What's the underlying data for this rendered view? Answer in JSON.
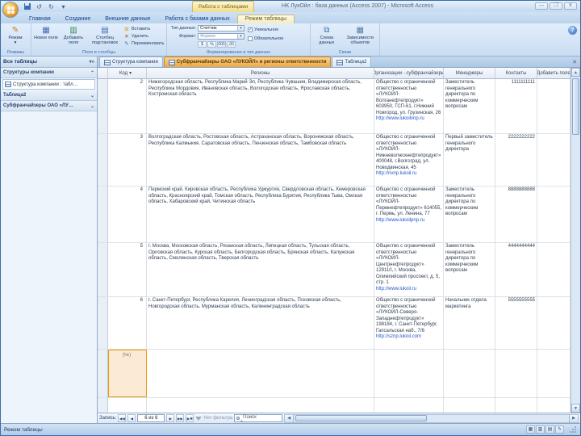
{
  "colors": {
    "active_doc_tab": "#efa743",
    "contextual_tab": "#f1dd8e",
    "title_bar": "#c2d9f0",
    "new_record_highlight": "#f0960f"
  },
  "window": {
    "title": "НК ЛукОйл : база данных (Access 2007) - Microsoft Access",
    "contextual_group": "Работа с таблицами",
    "controls": {
      "minimize": "—",
      "restore": "❐",
      "close": "✕"
    }
  },
  "ribbon": {
    "tabs": [
      "Главная",
      "Создание",
      "Внешние данные",
      "Работа с базами данных",
      "Режим таблицы"
    ],
    "views_group": {
      "label": "Режимы",
      "view_button": "Режим",
      "dropdown": "▾"
    },
    "fields_group": {
      "label": "Поля и столбцы",
      "new_field": "Новое поле",
      "add_fields": "Добавить поля",
      "lookup_column": "Столбец подстановок",
      "insert": "Вставить",
      "delete": "Удалить",
      "rename": "Переименовать"
    },
    "format_group": {
      "label": "Форматирование и тип данных",
      "data_type_label": "Тип данных:",
      "data_type_value": "Счетчик",
      "format_label": "Формат:",
      "format_value": "Формат",
      "unique": "Уникальное",
      "unique_checked": "✓",
      "required": "Обязательное",
      "money": "$",
      "percent": "%",
      "thousands": "000",
      "decimals": ",00"
    },
    "relations_group": {
      "label": "Связи",
      "schema": "Схема данных",
      "dependencies": "Зависимости объектов"
    },
    "help": "?"
  },
  "nav_pane": {
    "header": "Все таблицы",
    "header_dropdown": "▾",
    "header_collapse": "«",
    "groups": [
      {
        "label": "Структуры компании",
        "chevron": "⌃"
      },
      {
        "label": "Таблица2",
        "chevron": "⌄"
      },
      {
        "label": "Субфранчайзеры ОАО «ЛУ…",
        "chevron": "⌄"
      }
    ],
    "items": [
      {
        "label": "Структура компании : табл…"
      }
    ]
  },
  "doc_tabs": [
    {
      "label": "Структура компании"
    },
    {
      "label": "Субфранчайзеры ОАО «ЛУКОЙЛ» и регионы ответственности"
    },
    {
      "label": "Таблица2"
    }
  ],
  "doc_close": "✕",
  "table": {
    "columns": [
      "Код",
      "Регионы",
      "Организации - субфранчайзеры",
      "Менеджеры",
      "Контакты",
      "Добавить поле"
    ],
    "sort_arrow": "▾",
    "new_record_placeholder": "(№)",
    "rows": [
      {
        "code": "2",
        "regions": "Нижегородская область, Республика Марий Эл, Республика Чувашия, Владимирская область, Республика Мордовия, Ивановская область, Вологодская область, Ярославская область, Костромская область",
        "org": "Общество с ограниченной ответственностью «ЛУКОЙЛ-Волганефтепродукт» 603950, ГСП-61, г.Нижний Новгород, ул. Грузинская, 26",
        "url": "http://www.lukoilvnp.ru",
        "manager": "Заместитель генерального директора по коммерческим вопросам",
        "contact": "1111111111"
      },
      {
        "code": "3",
        "regions": "Волгоградская область, Ростовская область, Астраханская область, Воронежская область, Республика Калмыкия, Саратовская область, Пензенская область, Тамбовская область",
        "org": "Общество с ограниченной ответственностью «ЛУКОЙЛ-Нижневолжскнефтепродукт» 400048, г.Волгоград, ул. Новодвинская, 45",
        "url": "http://nvnp.lukoil.ru",
        "manager": "Первый заместитель генерального директора",
        "contact": "2222222222"
      },
      {
        "code": "4",
        "regions": "Пермский край, Кировская область, Республика Удмуртия, Свердловская область, Кемеровская область, Красноярский край, Томская область, Республика Бурятия, Республика Тыва, Омская область, Хабаровский край, Читинская область",
        "org": "Общество с ограниченной ответственностью «ЛУКОЙЛ-Пермнефтепродукт» 614055, г. Пермь, ул. Ленина, 77",
        "url": "http://www.lukoilpnp.ru",
        "manager": "Заместитель генерального директора по коммерческим вопросам",
        "contact": "8888888888"
      },
      {
        "code": "5",
        "regions": "г. Москва, Московская область, Рязанская область, Липецкая область, Тульская область, Орловская область, Курская область, Белгородская область, Брянская область, Калужская область, Смоленская область, Тверская область",
        "org": "Общество с ограниченной ответственностью «ЛУКОЙЛ-Центрнефтепродукт» 129110, г. Москва, Олимпийский проспект, д. 5, стр. 1",
        "url": "http://www.lukoil.ru",
        "manager": "Заместитель генерального директора по коммерческим вопросам",
        "contact": "4444444444"
      },
      {
        "code": "6",
        "regions": "г. Санкт-Петербург, Республика Карелия, Ленинградская область, Псковская область, Новгородская область, Мурманская область, Калининградская область",
        "org": "Общество с ограниченной ответственностью «ЛУКОЙЛ-Северо-Западнефтепродукт» 198184, г. Санкт-Петербург, Гапсальская наб., 7/6",
        "url": "http://sznp.lukoil.com",
        "manager": "Начальник отдела маркетинга",
        "contact": "5555555555"
      }
    ]
  },
  "record_navigator": {
    "label": "Запись:",
    "position": "6 из 6",
    "buttons": {
      "first": "◀◀",
      "prev": "◀",
      "next": "▶",
      "last": "▶▶",
      "new": "▶✱"
    },
    "filter_label": "Нет фильтра",
    "search_placeholder": "Поиск"
  },
  "status_bar": {
    "mode": "Режим таблицы"
  }
}
